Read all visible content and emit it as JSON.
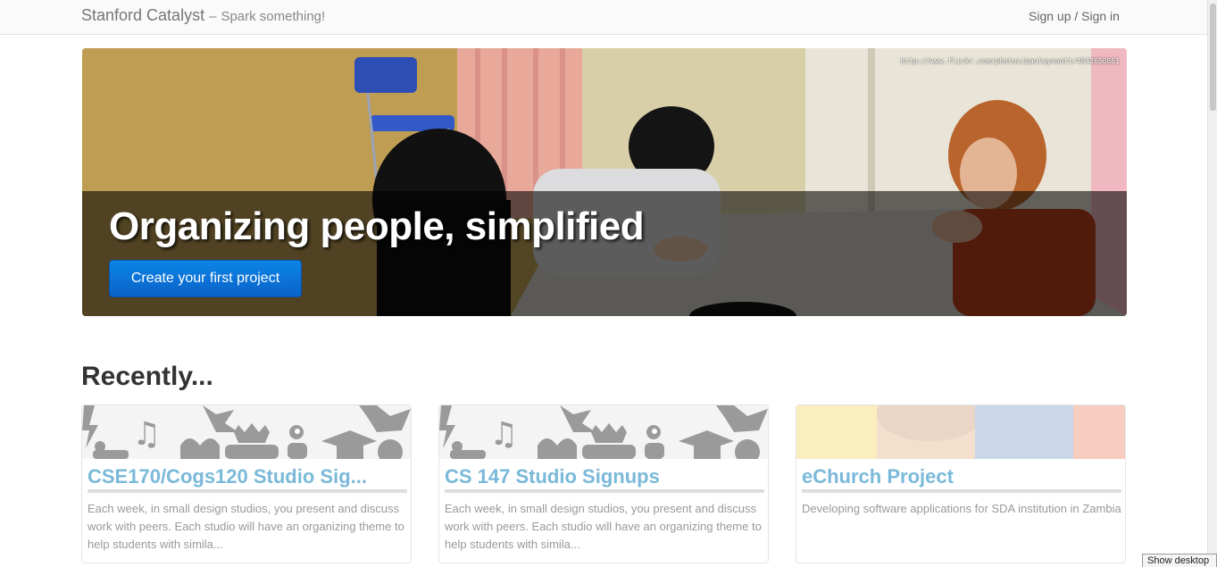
{
  "navbar": {
    "brand_name": "Stanford Catalyst",
    "brand_dash": "–",
    "tagline": "Spark something!",
    "signin_label": "Sign up / Sign in"
  },
  "hero": {
    "photo_credit": "http://www.flickr.com/photos/paulaynnott/4642650861",
    "headline": "Organizing people, simplified",
    "cta_label": "Create your first project"
  },
  "recently": {
    "heading": "Recently...",
    "cards": [
      {
        "title": "CSE170/Cogs120 Studio Sig...",
        "description": "Each week, in small design studios, you present and discuss work with peers. Each studio will have an organizing theme to help students with simila...",
        "banner": "icon-pattern"
      },
      {
        "title": "CS 147 Studio Signups",
        "description": "Each week, in small design studios, you present and discuss work with peers. Each studio will have an organizing theme to help students with simila...",
        "banner": "icon-pattern"
      },
      {
        "title": "eChurch Project",
        "description": "Developing software applications for SDA institution in Zambia",
        "banner": "photo"
      }
    ]
  },
  "taskbar": {
    "show_desktop_label": "Show desktop"
  },
  "colors": {
    "cta_blue": "#0a6fd6",
    "card_title": "#7ab9d9",
    "banner_icons": "#9a9a9a"
  }
}
